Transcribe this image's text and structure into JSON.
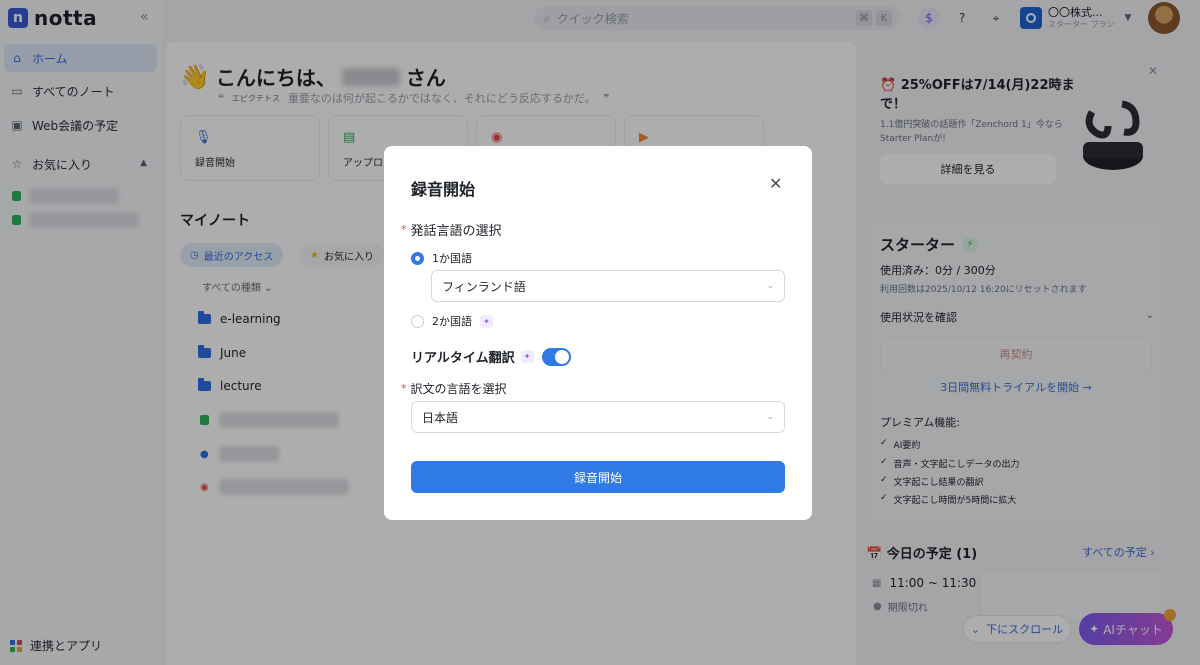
{
  "app": {
    "name": "notta"
  },
  "sidebar": {
    "items": [
      {
        "label": "ホーム",
        "icon": "home-icon"
      },
      {
        "label": "すべてのノート",
        "icon": "folder-icon"
      },
      {
        "label": "Web会議の予定",
        "icon": "calendar-icon"
      },
      {
        "label": "お気に入り",
        "icon": "star-icon"
      }
    ],
    "bottom_label": "連携とアプリ"
  },
  "topbar": {
    "search_placeholder": "クイック検索",
    "shortcut_keys": [
      "⌘",
      "K"
    ],
    "workspace_name": "〇〇株式...",
    "workspace_plan": "スターター プラン"
  },
  "home": {
    "greeting_prefix": "こんにちは、",
    "greeting_suffix": "さん",
    "quote_author": "エピクテトス",
    "quote_text": "重要なのは何が起こるかではなく、それにどう反応するかだ。",
    "quick_cards": [
      {
        "label": "録音開始"
      },
      {
        "label": "アップロ"
      },
      {
        "label": ""
      },
      {
        "label": ""
      }
    ],
    "my_notes_title": "マイノート",
    "chips": [
      {
        "label": "最近のアクセス"
      },
      {
        "label": "お気に入り"
      }
    ],
    "filter_label": "すべての種類",
    "folders": [
      {
        "name": "e-learning"
      },
      {
        "name": "June"
      },
      {
        "name": "lecture"
      }
    ]
  },
  "promo": {
    "title": "25%OFFは7/14(月)22時まで！",
    "subtitle": "1.1億円突破の話題作「Zenchord 1」今ならStarter Planが!",
    "button": "詳細を見る"
  },
  "plan": {
    "title": "スターター",
    "usage": "使用済み：0分 / 300分",
    "reset": "利用回数は2025/10/12 16:20にリセットされます",
    "usage_check": "使用状況を確認",
    "renew": "再契約",
    "trial": "3日間無料トライアルを開始 →",
    "premium_title": "プレミアム機能:",
    "features": [
      "AI要約",
      "音声・文字起こしデータの出力",
      "文字起こし結果の翻訳",
      "文字起こし時間が5時間に拡大"
    ]
  },
  "schedule": {
    "title": "今日の予定 (1)",
    "all_link": "すべての予定 ›",
    "time": "11:00 ~ 11:30",
    "status": "期限切れ"
  },
  "floating": {
    "scroll_down": "下にスクロール",
    "ai_chat": "AIチャット"
  },
  "modal": {
    "title": "録音開始",
    "language_label": "発話言語の選択",
    "option_one": "1か国語",
    "option_two": "2か国語",
    "language_value": "フィンランド語",
    "realtime_label": "リアルタイム翻訳",
    "realtime_enabled": true,
    "translation_label": "訳文の言語を選択",
    "translation_value": "日本語",
    "start_button": "録音開始"
  },
  "colors": {
    "accent": "#2f7ae5",
    "active_nav_bg": "#dde8f9",
    "ai_gradient_start": "#7c5cf0",
    "ai_gradient_end": "#c458d8",
    "required": "#e5484d"
  }
}
